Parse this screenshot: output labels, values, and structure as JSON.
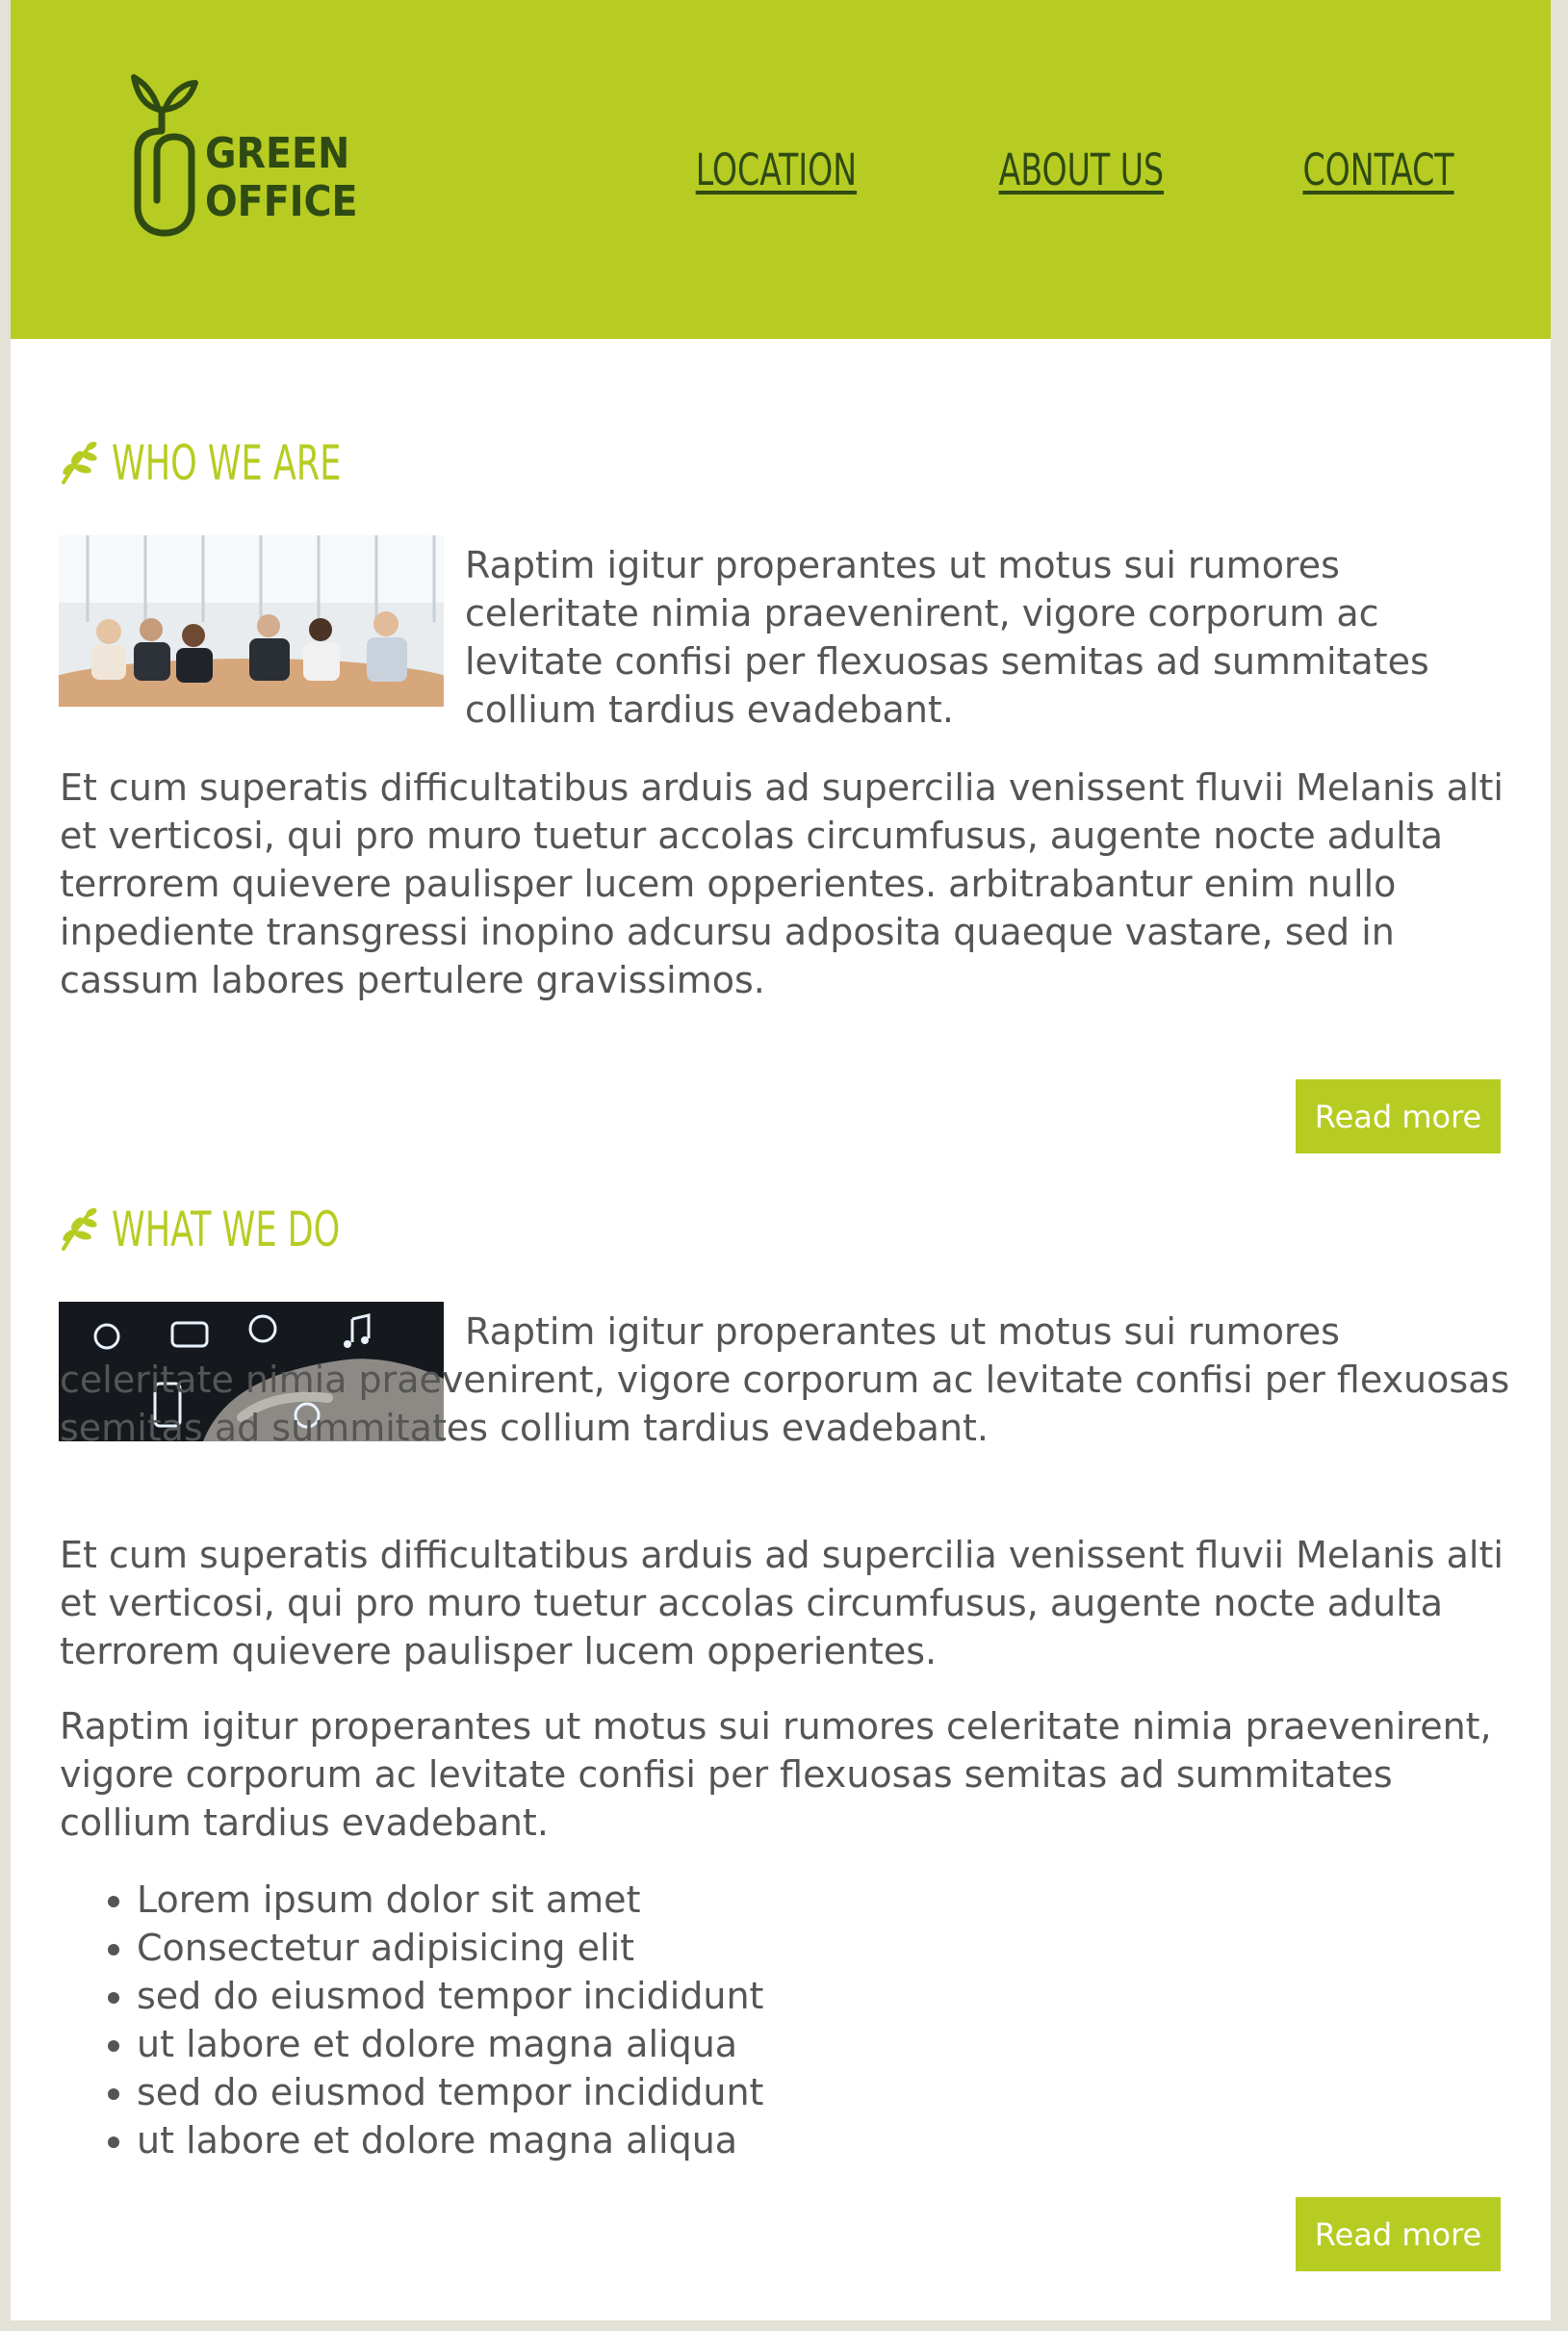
{
  "header": {
    "logo": {
      "line1": "GREEN",
      "line2": "OFFICE",
      "icon": "paperclip-sprout-icon"
    },
    "nav": [
      "LOCATION",
      "ABOUT US",
      "CONTACT"
    ]
  },
  "colors": {
    "brand": "#b6cc22",
    "nav_text": "#2f4a13",
    "body_text": "#555555",
    "background": "#e4e1d8"
  },
  "sections": [
    {
      "title": "WHO WE ARE",
      "icon": "leaf-icon",
      "image": "business-team-photo",
      "intro": "Raptim igitur properantes ut motus sui rumores celeritate nimia praevenirent, vigore corporum ac levitate confisi per flexuosas semitas ad summitates collium tardius evadebant.",
      "paragraphs": [
        "Et cum superatis difficultatibus arduis ad supercilia venissent fluvii Melanis alti et verticosi, qui pro muro tuetur accolas circumfusus, augente nocte adulta terrorem quievere paulisper lucem opperientes. arbitrabantur enim nullo inpediente transgressi inopino adcursu adposita quaeque vastare, sed in cassum labores pertulere gravissimos."
      ],
      "button": "Read more"
    },
    {
      "title": "WHAT WE DO",
      "icon": "leaf-icon",
      "image": "touchscreen-technology-photo",
      "intro": "Raptim igitur properantes ut motus sui rumores celeritate nimia praevenirent, vigore corporum ac levitate confisi per flexuosas semitas ad summitates collium tardius evadebant.",
      "paragraphs": [
        "Et cum superatis difficultatibus arduis ad supercilia venissent fluvii Melanis alti et verticosi, qui pro muro tuetur accolas circumfusus, augente nocte adulta terrorem quievere paulisper lucem opperientes.",
        "Raptim igitur properantes ut motus sui rumores celeritate nimia praevenirent, vigore corporum ac levitate confisi per flexuosas semitas ad summitates collium tardius evadebant."
      ],
      "list": [
        "Lorem ipsum dolor sit amet",
        "Consectetur adipisicing elit",
        "sed do eiusmod tempor incididunt",
        "ut labore et dolore magna aliqua",
        "sed do eiusmod tempor incididunt",
        "ut labore et dolore magna aliqua"
      ],
      "button": "Read more"
    }
  ]
}
